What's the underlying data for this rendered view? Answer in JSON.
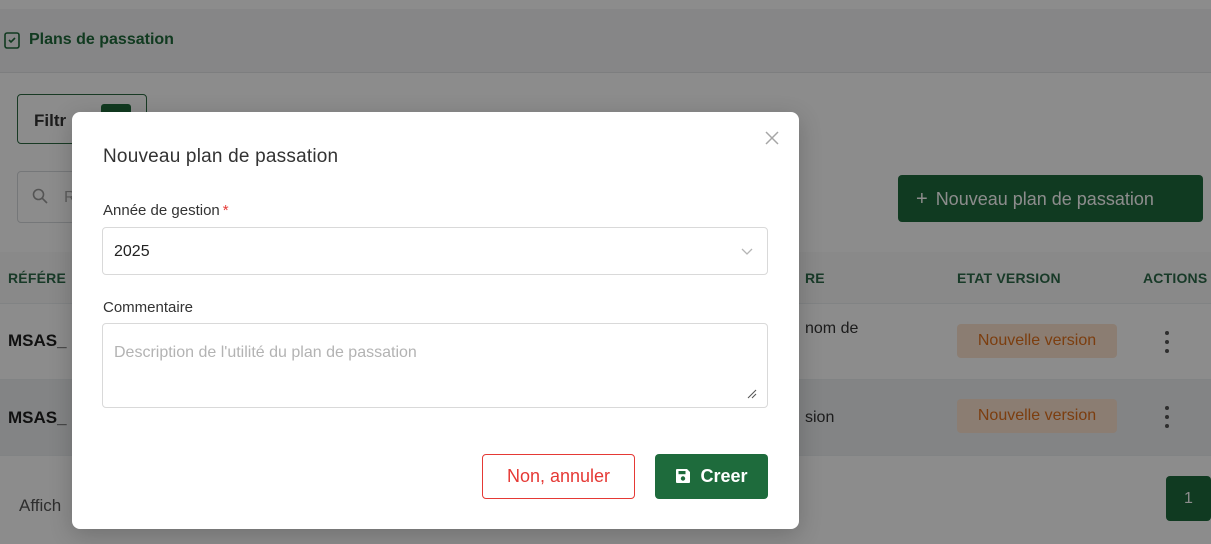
{
  "header": {
    "title": "Plans de passation"
  },
  "toolbar": {
    "filter_label": "Filtr",
    "search_placeholder": "R",
    "new_button_label": "Nouveau plan de passation",
    "new_button_icon": "+"
  },
  "table": {
    "headers": [
      "RÉFÉRE",
      "RE",
      "ETAT VERSION",
      "ACTIONS"
    ],
    "rows": [
      {
        "ref": "MSAS_",
        "comment": "nom de",
        "etat": "Nouvelle version"
      },
      {
        "ref": "MSAS_",
        "comment": "sion",
        "etat": "Nouvelle version"
      }
    ]
  },
  "footer": {
    "showing_text": "Affich",
    "page": "1"
  },
  "modal": {
    "title": "Nouveau plan de passation",
    "year_label": "Année de gestion",
    "year_required": "*",
    "year_value": "2025",
    "comment_label": "Commentaire",
    "comment_placeholder": "Description de l'utilité du plan de passation",
    "cancel_label": "Non, annuler",
    "create_label": "Creer"
  },
  "colors": {
    "primary": "#1e6b3c",
    "danger": "#e53935",
    "badge_bg": "#fde3cf",
    "badge_text": "#e2711d"
  }
}
